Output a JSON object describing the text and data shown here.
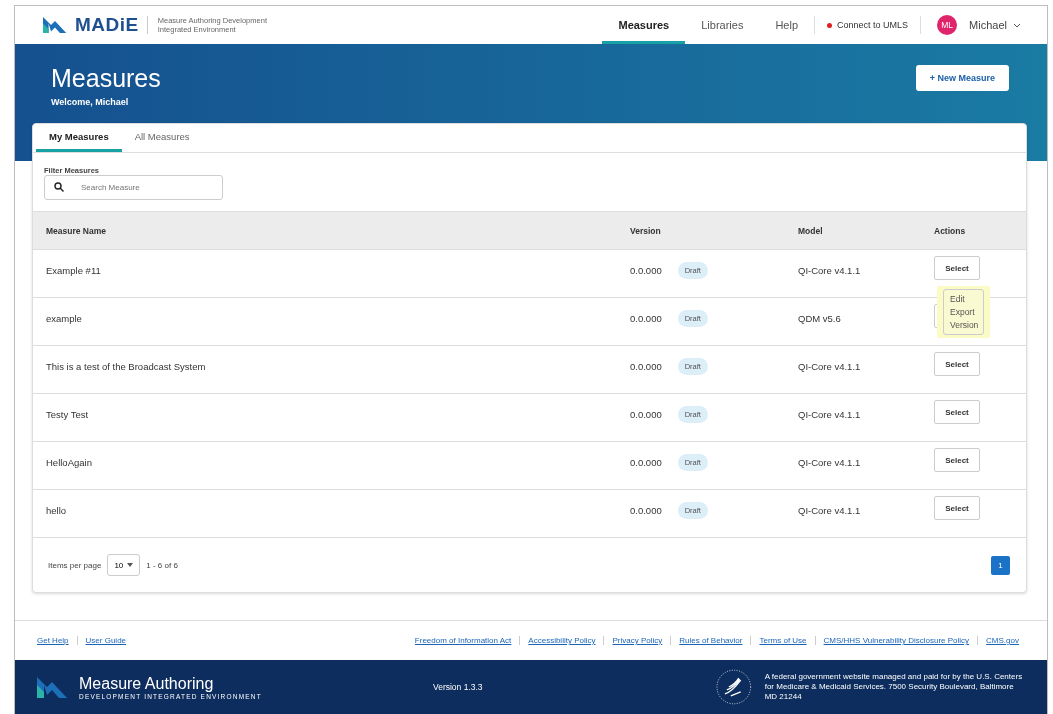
{
  "header": {
    "logo": "MADiE",
    "subtitle": "Measure Authoring Development Integrated Environment",
    "nav": [
      {
        "label": "Measures",
        "selected": true
      },
      {
        "label": "Libraries",
        "selected": false
      },
      {
        "label": "Help",
        "selected": false
      }
    ],
    "umls": {
      "label": "Connect to UMLS",
      "connected": false
    },
    "user": {
      "initials": "ML",
      "name": "Michael"
    }
  },
  "banner": {
    "title": "Measures",
    "welcome": "Welcome, Michael",
    "new_button": "+ New Measure"
  },
  "tabs": [
    {
      "label": "My Measures",
      "selected": true
    },
    {
      "label": "All Measures",
      "selected": false
    }
  ],
  "filter": {
    "label": "Filter Measures",
    "placeholder": "Search Measure"
  },
  "table": {
    "columns": [
      "Measure Name",
      "Version",
      "Model",
      "Actions"
    ],
    "rows": [
      {
        "name": "Example #11",
        "version": "0.0.000",
        "status": "Draft",
        "model": "QI-Core v4.1.1",
        "action": "Select"
      },
      {
        "name": "example",
        "version": "0.0.000",
        "status": "Draft",
        "model": "QDM v5.6"
      },
      {
        "name": "This is a test of the Broadcast System",
        "version": "0.0.000",
        "status": "Draft",
        "model": "QI-Core v4.1.1",
        "action": "Select"
      },
      {
        "name": "Testy Test",
        "version": "0.0.000",
        "status": "Draft",
        "model": "QI-Core v4.1.1",
        "action": "Select"
      },
      {
        "name": "HelloAgain",
        "version": "0.0.000",
        "status": "Draft",
        "model": "QI-Core v4.1.1",
        "action": "Select"
      },
      {
        "name": "hello",
        "version": "0.0.000",
        "status": "Draft",
        "model": "QI-Core v4.1.1",
        "action": "Select"
      }
    ]
  },
  "action_menu": {
    "open": true,
    "items": [
      "Edit",
      "Export",
      "Version"
    ]
  },
  "pagination": {
    "label": "Items per page",
    "per_page": "10",
    "range": "1 - 6 of 6",
    "pages": [
      {
        "label": "1",
        "selected": true
      }
    ]
  },
  "footer_links_left": [
    "Get Help",
    "User Guide"
  ],
  "footer_links_right": [
    "Freedom of Information Act",
    "Accessibility Policy",
    "Privacy Policy",
    "Rules of Behavior",
    "Terms of Use",
    "CMS/HHS Vulnerability Disclosure Policy",
    "CMS.gov"
  ],
  "footer": {
    "title": "Measure Authoring",
    "tagline": "DEVELOPMENT INTEGRATED ENVIRONMENT",
    "version": "Version 1.3.3",
    "notice": "A federal government website managed and paid for by the U.S. Centers for Medicare & Medicaid Services. 7500 Security Boulevard, Baltimore MD 21244"
  }
}
